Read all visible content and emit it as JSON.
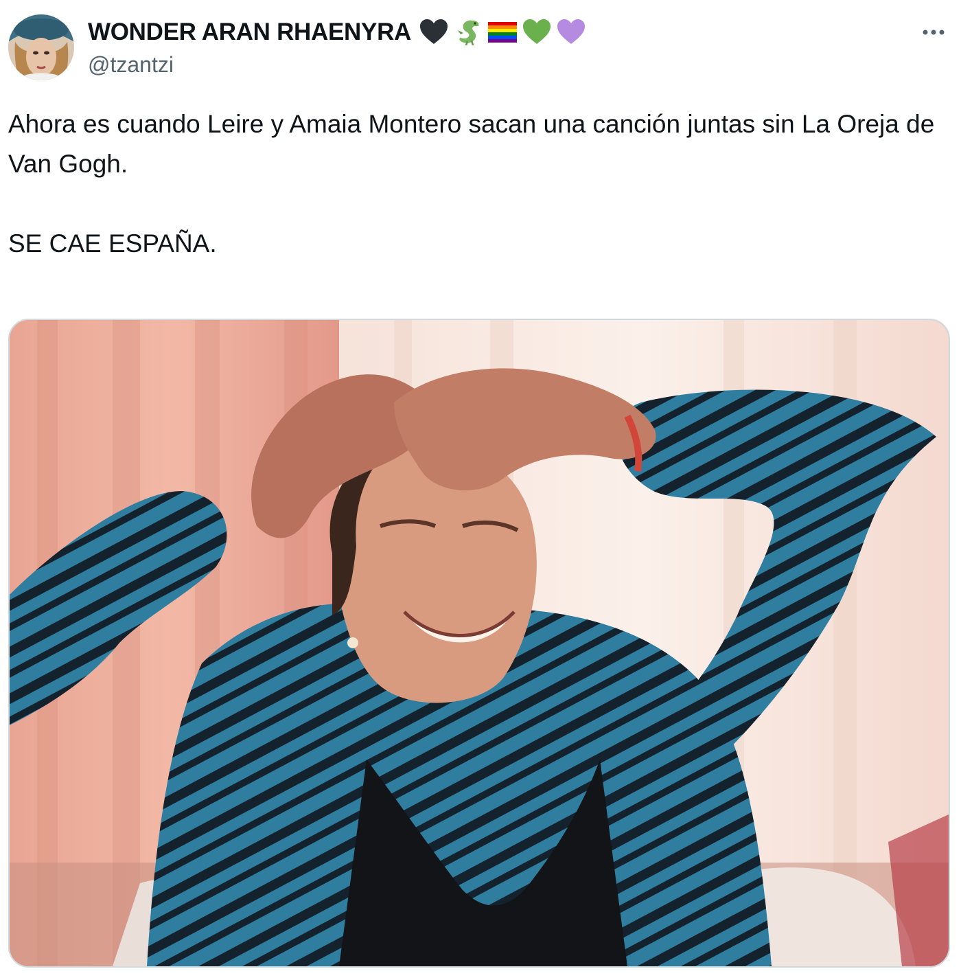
{
  "tweet": {
    "author": {
      "display_name": "WONDER ARAN RHAENYRA",
      "handle": "@tzantzi",
      "name_emojis": [
        "black-heart-icon",
        "dragon-icon",
        "rainbow-flag-icon",
        "green-heart-icon",
        "purple-heart-icon"
      ]
    },
    "text": {
      "line1": "Ahora es cuando Leire y Amaia Montero sacan una canción juntas sin La Oreja de Van Gogh.",
      "line2": "SE CAE ESPAÑA."
    },
    "more_icon": "more-horizontal-icon",
    "colors": {
      "text": "#0f1419",
      "secondary": "#536471",
      "border": "#cfd9de"
    }
  }
}
